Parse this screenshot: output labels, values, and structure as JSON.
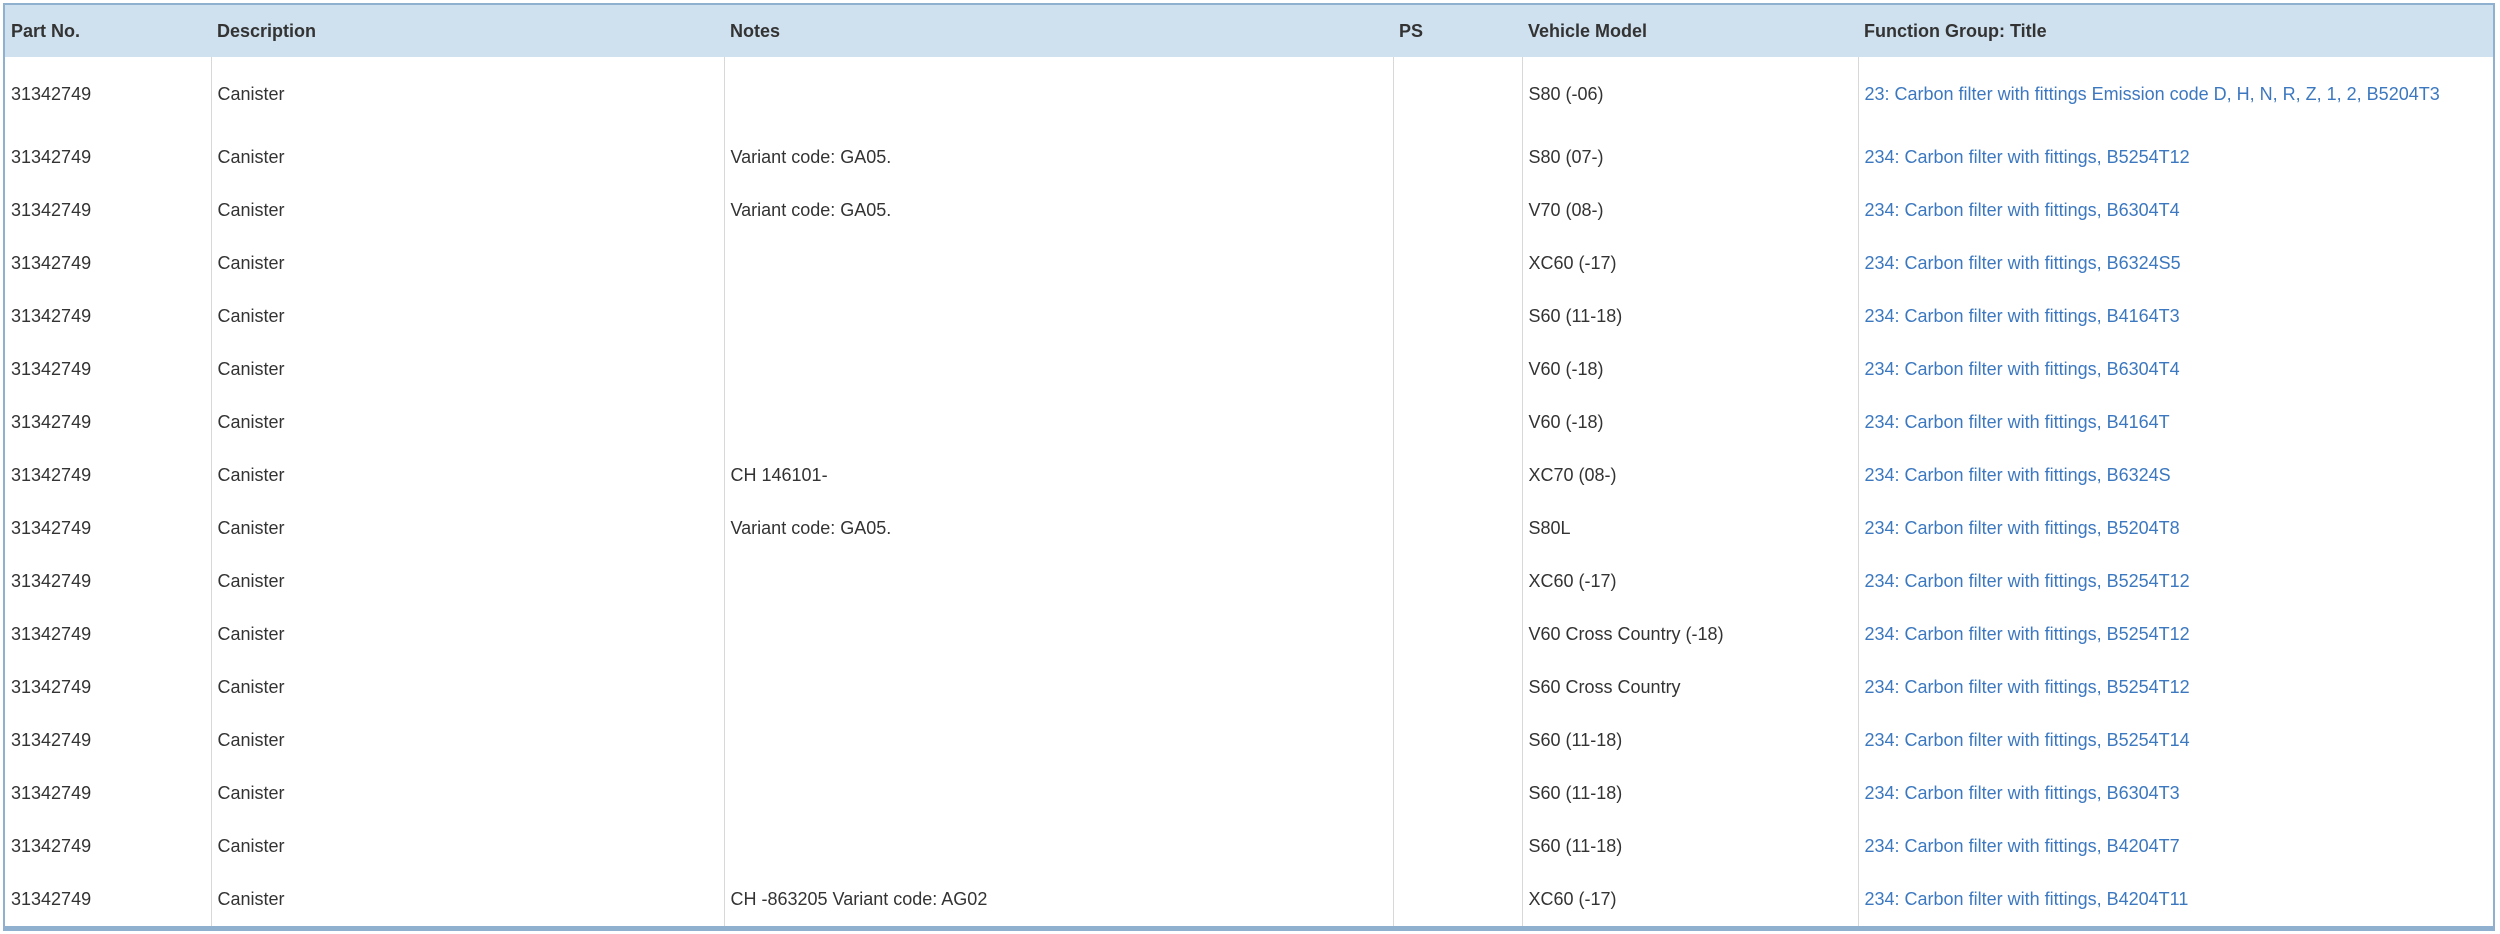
{
  "headers": {
    "part_no": "Part No.",
    "description": "Description",
    "notes": "Notes",
    "ps": "PS",
    "vehicle_model": "Vehicle Model",
    "function_group": "Function Group: Title"
  },
  "colors": {
    "header_bg": "#cfe0ef",
    "link": "#3c78c0",
    "border": "#8fb1cf"
  },
  "rows": [
    {
      "part_no": "31342749",
      "description": "Canister",
      "notes": "",
      "ps": "",
      "vehicle_model": "S80 (-06)",
      "function_group": "23: Carbon filter with fittings Emission code D, H, N, R, Z, 1, 2, B5204T3"
    },
    {
      "part_no": "31342749",
      "description": "Canister",
      "notes": "Variant code: GA05.",
      "ps": "",
      "vehicle_model": "S80 (07-)",
      "function_group": "234: Carbon filter with fittings, B5254T12"
    },
    {
      "part_no": "31342749",
      "description": "Canister",
      "notes": "Variant code: GA05.",
      "ps": "",
      "vehicle_model": "V70 (08-)",
      "function_group": "234: Carbon filter with fittings, B6304T4"
    },
    {
      "part_no": "31342749",
      "description": "Canister",
      "notes": "",
      "ps": "",
      "vehicle_model": "XC60 (-17)",
      "function_group": "234: Carbon filter with fittings, B6324S5"
    },
    {
      "part_no": "31342749",
      "description": "Canister",
      "notes": "",
      "ps": "",
      "vehicle_model": "S60 (11-18)",
      "function_group": "234: Carbon filter with fittings, B4164T3"
    },
    {
      "part_no": "31342749",
      "description": "Canister",
      "notes": "",
      "ps": "",
      "vehicle_model": "V60 (-18)",
      "function_group": "234: Carbon filter with fittings, B6304T4"
    },
    {
      "part_no": "31342749",
      "description": "Canister",
      "notes": "",
      "ps": "",
      "vehicle_model": "V60 (-18)",
      "function_group": "234: Carbon filter with fittings, B4164T"
    },
    {
      "part_no": "31342749",
      "description": "Canister",
      "notes": "CH 146101-",
      "ps": "",
      "vehicle_model": "XC70 (08-)",
      "function_group": "234: Carbon filter with fittings, B6324S"
    },
    {
      "part_no": "31342749",
      "description": "Canister",
      "notes": "Variant code: GA05.",
      "ps": "",
      "vehicle_model": "S80L",
      "function_group": "234: Carbon filter with fittings, B5204T8"
    },
    {
      "part_no": "31342749",
      "description": "Canister",
      "notes": "",
      "ps": "",
      "vehicle_model": "XC60 (-17)",
      "function_group": "234: Carbon filter with fittings, B5254T12"
    },
    {
      "part_no": "31342749",
      "description": "Canister",
      "notes": "",
      "ps": "",
      "vehicle_model": "V60 Cross Country (-18)",
      "function_group": "234: Carbon filter with fittings, B5254T12"
    },
    {
      "part_no": "31342749",
      "description": "Canister",
      "notes": "",
      "ps": "",
      "vehicle_model": "S60 Cross Country",
      "function_group": "234: Carbon filter with fittings, B5254T12"
    },
    {
      "part_no": "31342749",
      "description": "Canister",
      "notes": "",
      "ps": "",
      "vehicle_model": "S60 (11-18)",
      "function_group": "234: Carbon filter with fittings, B5254T14"
    },
    {
      "part_no": "31342749",
      "description": "Canister",
      "notes": "",
      "ps": "",
      "vehicle_model": "S60 (11-18)",
      "function_group": "234: Carbon filter with fittings, B6304T3"
    },
    {
      "part_no": "31342749",
      "description": "Canister",
      "notes": "",
      "ps": "",
      "vehicle_model": "S60 (11-18)",
      "function_group": "234: Carbon filter with fittings, B4204T7"
    },
    {
      "part_no": "31342749",
      "description": "Canister",
      "notes": "CH -863205 Variant code: AG02",
      "ps": "",
      "vehicle_model": "XC60 (-17)",
      "function_group": "234: Carbon filter with fittings, B4204T11"
    }
  ]
}
